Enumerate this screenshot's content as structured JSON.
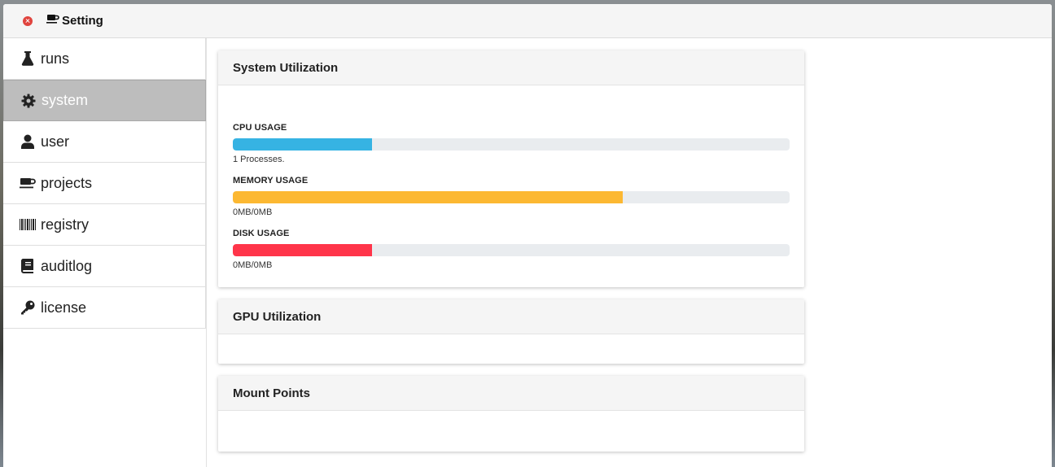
{
  "window": {
    "title": "Setting",
    "title_icon": "coffee-cup-icon"
  },
  "sidebar": {
    "items": [
      {
        "label": "runs",
        "icon": "flask-icon",
        "active": false
      },
      {
        "label": "system",
        "icon": "gear-icon",
        "active": true
      },
      {
        "label": "user",
        "icon": "user-icon",
        "active": false
      },
      {
        "label": "projects",
        "icon": "coffee-cup-icon",
        "active": false
      },
      {
        "label": "registry",
        "icon": "barcode-icon",
        "active": false
      },
      {
        "label": "auditlog",
        "icon": "book-icon",
        "active": false
      },
      {
        "label": "license",
        "icon": "key-icon",
        "active": false
      }
    ]
  },
  "main": {
    "system_utilization": {
      "title": "System Utilization",
      "cpu": {
        "label": "CPU USAGE",
        "detail": "1 Processes.",
        "fraction": 0.25,
        "color": "#36b3e3"
      },
      "memory": {
        "label": "MEMORY USAGE",
        "detail": "0MB/0MB",
        "fraction": 0.7,
        "color": "#fcb832"
      },
      "disk": {
        "label": "DISK USAGE",
        "detail": "0MB/0MB",
        "fraction": 0.25,
        "color": "#ff354a"
      }
    },
    "gpu_utilization": {
      "title": "GPU Utilization"
    },
    "mount_points": {
      "title": "Mount Points"
    }
  },
  "colors": {
    "sidebar_active_bg": "#bdbdbd",
    "close_button": "#e0443e"
  }
}
